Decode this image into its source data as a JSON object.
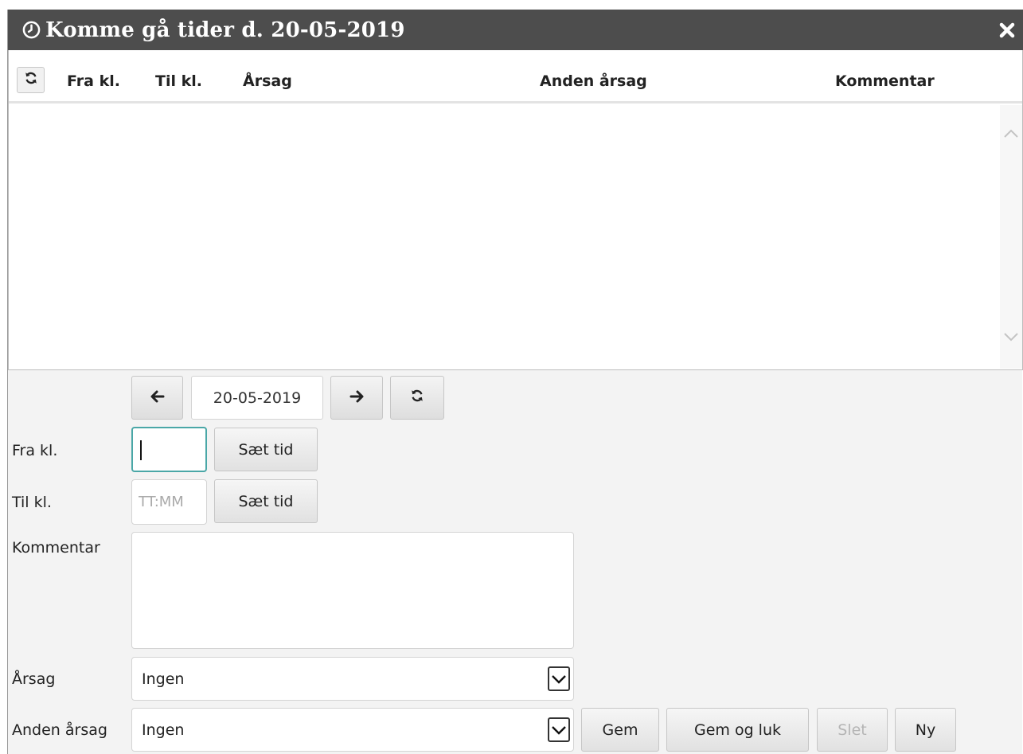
{
  "dialog": {
    "title": "Komme gå tider d. 20-05-2019",
    "title_icon": "clock-icon",
    "close_icon": "close-icon"
  },
  "grid": {
    "refresh_icon": "refresh-icon",
    "columns": {
      "fra": "Fra kl.",
      "til": "Til kl.",
      "aarsag": "Årsag",
      "anden_aarsag": "Anden årsag",
      "kommentar": "Kommentar"
    },
    "rows": []
  },
  "date_nav": {
    "date": "20-05-2019",
    "prev_icon": "arrow-left-icon",
    "next_icon": "arrow-right-icon",
    "refresh_icon": "refresh-icon"
  },
  "form": {
    "fra_label": "Fra kl.",
    "fra_value": "",
    "til_label": "Til kl.",
    "til_placeholder": "TT:MM",
    "set_time_label": "Sæt tid",
    "kommentar_label": "Kommentar",
    "kommentar_value": "",
    "aarsag_label": "Årsag",
    "aarsag_value": "Ingen",
    "anden_aarsag_label": "Anden årsag",
    "anden_aarsag_value": "Ingen"
  },
  "actions": {
    "save": "Gem",
    "save_close": "Gem og luk",
    "delete": "Slet",
    "new": "Ny"
  },
  "colors": {
    "titlebar": "#4d4d4d",
    "panel": "#f3f3f3",
    "focus": "#4aa7a7"
  }
}
